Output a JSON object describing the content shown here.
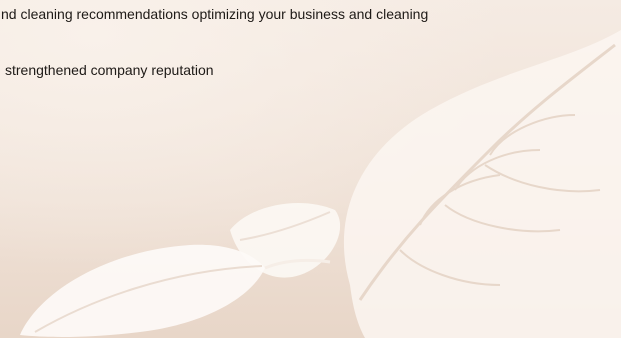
{
  "content": {
    "line_1": "nd cleaning recommendations optimizing your business and cleaning",
    "line_2": "strengthened company reputation"
  },
  "background": {
    "base_color": "#f1e5dc",
    "leaf_color": "#fbf6f1",
    "vein_color": "#e7d7ca"
  }
}
